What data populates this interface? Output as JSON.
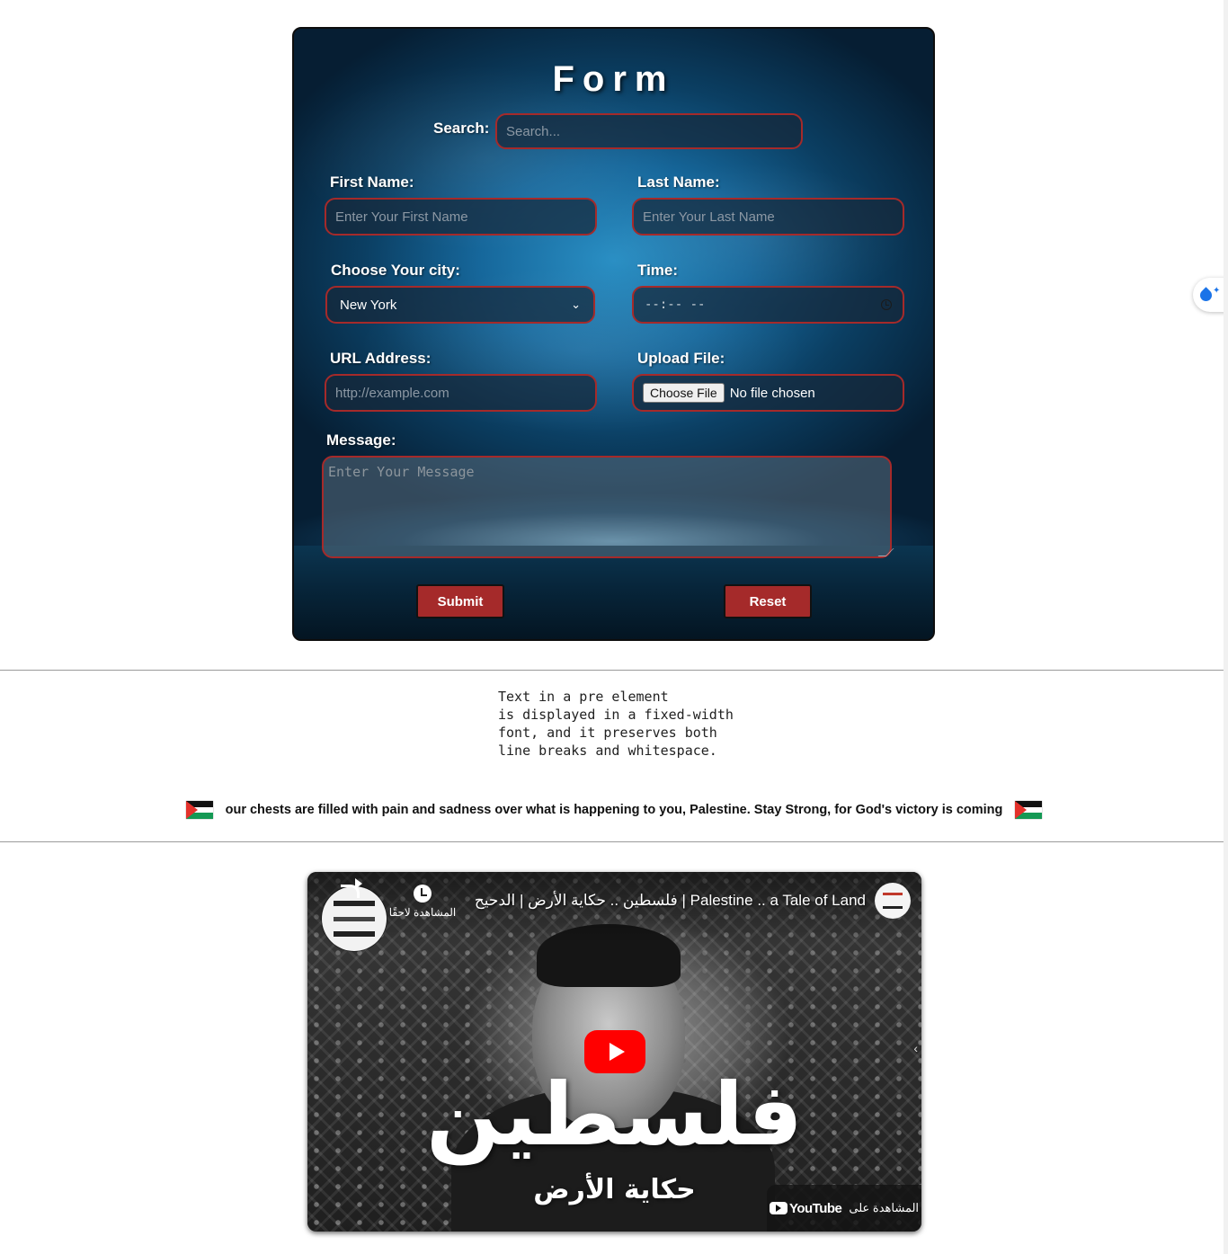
{
  "form": {
    "title": "Form",
    "search": {
      "label": "Search:",
      "placeholder": "Search..."
    },
    "first_name": {
      "label": "First Name:",
      "placeholder": "Enter Your First Name"
    },
    "last_name": {
      "label": "Last Name:",
      "placeholder": "Enter Your Last Name"
    },
    "city": {
      "label": "Choose Your city:",
      "selected": "New York"
    },
    "time": {
      "label": "Time:",
      "value": "--:-- --"
    },
    "url": {
      "label": "URL Address:",
      "placeholder": "http://example.com"
    },
    "upload": {
      "label": "Upload File:",
      "button": "Choose File",
      "status": "No file chosen"
    },
    "message": {
      "label": "Message:",
      "placeholder": "Enter Your Message"
    },
    "submit_label": "Submit",
    "reset_label": "Reset"
  },
  "pre_text": "Text in a pre element\nis displayed in a fixed-width\nfont, and it preserves both\nline breaks and whitespace.",
  "banner": {
    "text": "our chests are filled with pain and sadness over what is happening to you, Palestine. Stay Strong, for God's victory is coming",
    "flag_icon": "palestine-flag-icon"
  },
  "video": {
    "title": "فلسطين .. حكاية الأرض | الدحيح | Palestine .. a Tale of Land",
    "watch_later": "المشاهدة لاحقًا",
    "big_text": "فلسطين",
    "sub_text": "حكاية الأرض",
    "watch_on": "المشاهدة على",
    "youtube_label": "YouTube"
  },
  "colors": {
    "accent_red": "#a52a2a",
    "card_blue": "#16679b",
    "youtube_red": "#ff0000"
  }
}
